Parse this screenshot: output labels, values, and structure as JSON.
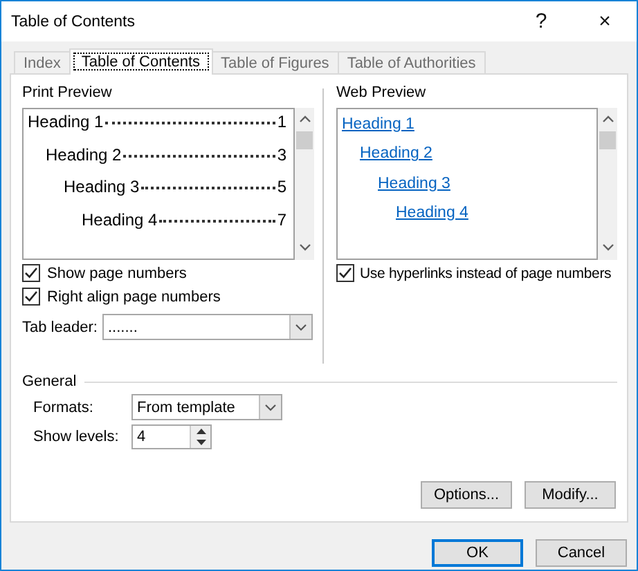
{
  "window": {
    "title": "Table of Contents",
    "help": "?",
    "close": "×"
  },
  "tabs": [
    {
      "label": "Index",
      "selected": false
    },
    {
      "label": "Table of Contents",
      "selected": true
    },
    {
      "label": "Table of Figures",
      "selected": false
    },
    {
      "label": "Table of Authorities",
      "selected": false
    }
  ],
  "print_preview": {
    "label": "Print Preview",
    "entries": [
      {
        "text": "Heading 1",
        "page": "1",
        "children": [
          {
            "text": "Heading 2",
            "page": "3",
            "children": [
              {
                "text": "Heading 3",
                "page": "5",
                "children": [
                  {
                    "text": "Heading 4",
                    "page": "7"
                  }
                ]
              }
            ]
          }
        ]
      }
    ]
  },
  "web_preview": {
    "label": "Web Preview",
    "entries": [
      {
        "text": "Heading 1",
        "children": [
          {
            "text": "Heading 2",
            "children": [
              {
                "text": "Heading 3",
                "children": [
                  {
                    "text": "Heading 4"
                  }
                ]
              }
            ]
          }
        ]
      }
    ]
  },
  "options_left": [
    {
      "label": "Show page numbers",
      "checked": true
    },
    {
      "label": "Right align page numbers",
      "checked": true
    }
  ],
  "tab_leader": {
    "label": "Tab leader:",
    "value": "......."
  },
  "options_right": [
    {
      "label": "Use hyperlinks instead of page numbers",
      "checked": true
    }
  ],
  "general": {
    "label": "General",
    "formats": {
      "label": "Formats:",
      "value": "From template"
    },
    "show_levels": {
      "label": "Show levels:",
      "value": "4"
    }
  },
  "buttons": [
    {
      "label": "Options..."
    },
    {
      "label": "Modify..."
    }
  ],
  "footer_buttons": [
    {
      "label": "OK",
      "kind": "default"
    },
    {
      "label": "Cancel",
      "kind": "normal"
    }
  ]
}
